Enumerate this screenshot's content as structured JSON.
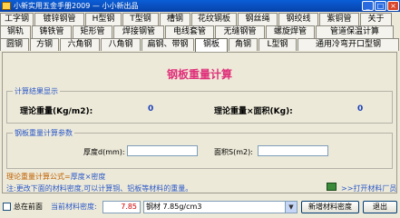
{
  "window": {
    "title": "小新实用五金手册2009 — 小小新出品",
    "buttons": [
      "_",
      "□",
      "×"
    ]
  },
  "tabs_row1": [
    "工字钢",
    "镀锌钢管",
    "H型钢",
    "T型钢",
    "槽钢",
    "花纹钢板",
    "钢丝绳",
    "钢绞线",
    "紫铜管",
    "关于"
  ],
  "tabs_row2": [
    "钢轨",
    "铸铁管",
    "矩形管",
    "焊接钢管",
    "电线套管",
    "无缝钢管",
    "螺旋焊管",
    "管道保温计算"
  ],
  "tabs_row3": [
    "圆钢",
    "方钢",
    "六角钢",
    "八角钢",
    "扁钢、带钢",
    "钢板",
    "角钢",
    "L型钢",
    "通用冷弯开口型钢"
  ],
  "active_tab": "钢板",
  "panel": {
    "heading": "钢板重量计算",
    "result_group": "计算结果显示",
    "theory_weight_label": "理论重量(Kg/m2):",
    "theory_weight_value": "0",
    "theory_weight_area_label": "理论重量×面积(Kg):",
    "theory_weight_area_value": "0",
    "params_group": "钢板重量计算参数",
    "thickness_label": "厚度d(mm):",
    "thickness_value": "",
    "area_label": "面积S(m2):",
    "area_value": "",
    "formula_label": "理论重量计算公式=",
    "formula_value": "厚度×密度",
    "note": "注:更改下面的材料密度,可以计算铜、铝板等材料的重量。",
    "open_material_link": ">>打开材料厂员"
  },
  "bottom": {
    "always_on_top_label": "总在前面",
    "always_on_top_checked": false,
    "density_label": "当前材料密度:",
    "density_value": "7.85",
    "material_select": "钢材 7.85g/cm3",
    "add_density_button": "新增材料密度",
    "close_button": "退出"
  }
}
